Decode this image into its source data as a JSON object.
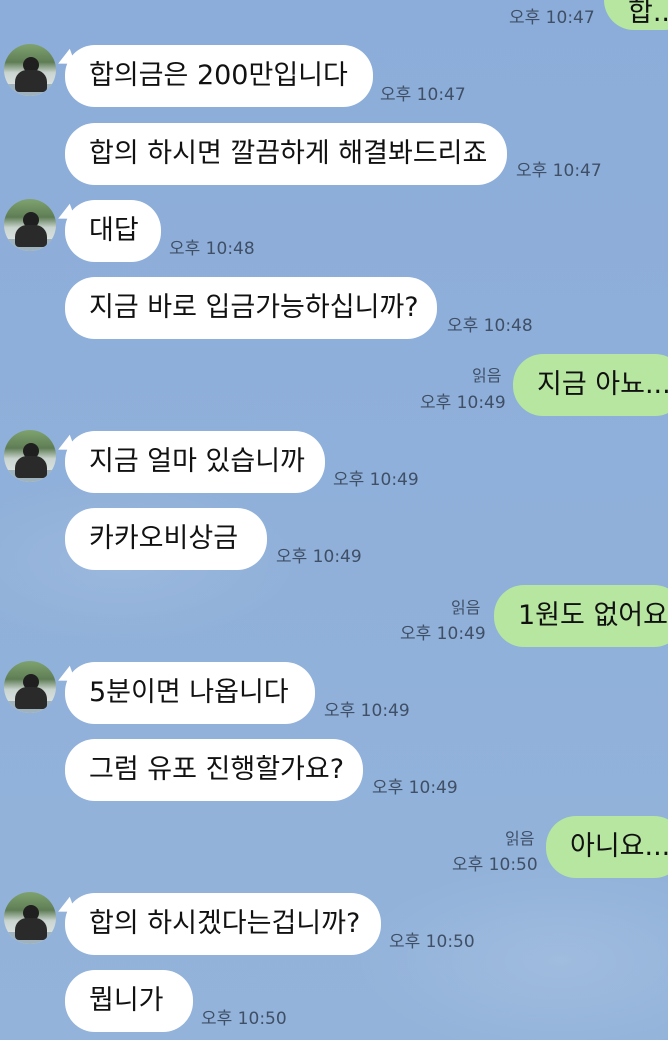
{
  "chat": {
    "top_partial": {
      "text": "합..",
      "time": "오후 10:47"
    },
    "messages": [
      {
        "text": "합의금은 200만입니다",
        "time": "오후 10:47"
      },
      {
        "text": "합의 하시면 깔끔하게 해결봐드리죠",
        "time": "오후 10:47"
      },
      {
        "text": "대답",
        "time": "오후 10:48"
      },
      {
        "text": "지금 바로 입금가능하십니까?",
        "time": "오후 10:48"
      },
      {
        "text": "지금 아뇨...",
        "time": "오후 10:49",
        "read": "읽음"
      },
      {
        "text": "지금 얼마 있습니까",
        "time": "오후 10:49"
      },
      {
        "text": "카카오비상금",
        "time": "오후 10:49"
      },
      {
        "text": "1원도 없어요",
        "time": "오후 10:49",
        "read": "읽음"
      },
      {
        "text": "5분이면 나옵니다",
        "time": "오후 10:49"
      },
      {
        "text": "그럼 유포 진행할가요?",
        "time": "오후 10:49"
      },
      {
        "text": "아니요...",
        "time": "오후 10:50",
        "read": "읽음"
      },
      {
        "text": "합의 하시겠다는겁니까?",
        "time": "오후 10:50"
      },
      {
        "text": "뭡니가",
        "time": "오후 10:50"
      }
    ]
  },
  "colors": {
    "background": "#8fb0d9",
    "incoming_bubble": "#ffffff",
    "outgoing_bubble": "#b6e6a0",
    "meta_text": "#3f4f66"
  },
  "icons": {
    "avatar": "profile-avatar-icon"
  }
}
